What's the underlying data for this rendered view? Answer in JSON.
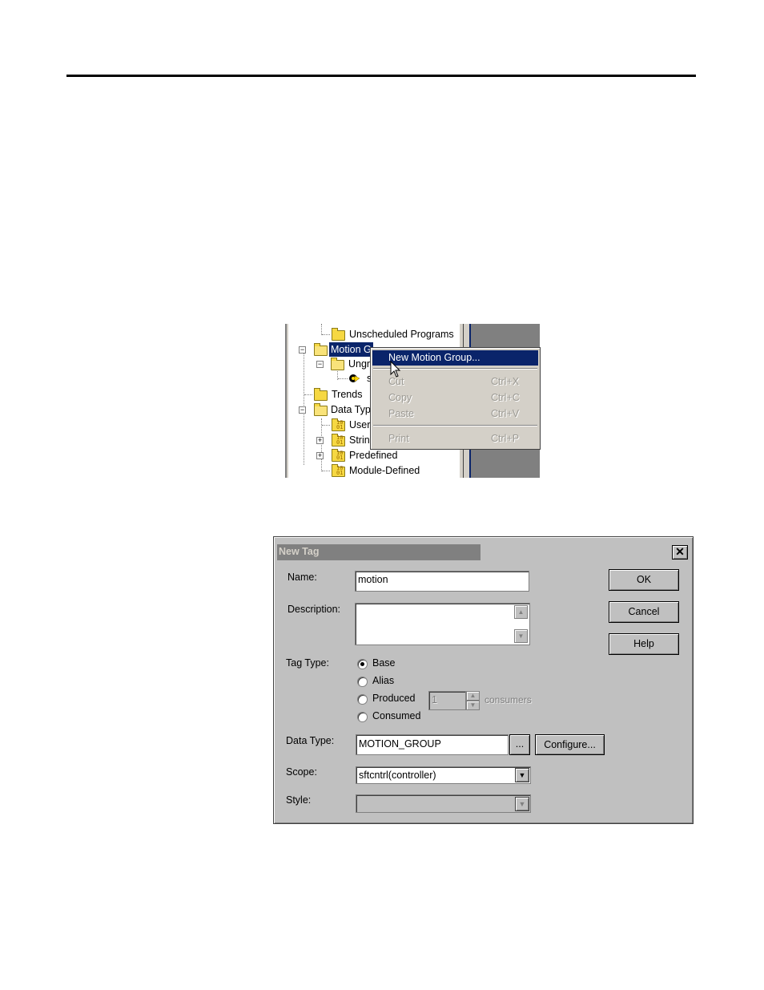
{
  "tree": {
    "items": [
      {
        "label": "Unscheduled Programs"
      },
      {
        "label": "Motion G"
      },
      {
        "label": "Ungr"
      },
      {
        "label": "s"
      },
      {
        "label": "Trends"
      },
      {
        "label": "Data Typ"
      },
      {
        "label": "User"
      },
      {
        "label": "Strin"
      },
      {
        "label": "Predefined"
      },
      {
        "label": "Module-Defined"
      }
    ]
  },
  "context_menu": {
    "items": [
      {
        "label": "New Motion Group...",
        "shortcut": ""
      },
      {
        "label": "Cut",
        "shortcut": "Ctrl+X"
      },
      {
        "label": "Copy",
        "shortcut": "Ctrl+C"
      },
      {
        "label": "Paste",
        "shortcut": "Ctrl+V"
      },
      {
        "label": "Print",
        "shortcut": "Ctrl+P"
      }
    ]
  },
  "dialog": {
    "title": "New Tag",
    "close": "✕",
    "name_label": "Name:",
    "name_value": "motion",
    "description_label": "Description:",
    "description_value": "",
    "tag_type_label": "Tag Type:",
    "tag_type_options": [
      "Base",
      "Alias",
      "Produced",
      "Consumed"
    ],
    "tag_type_selected": "Base",
    "consumers_value": "1",
    "consumers_label": "consumers",
    "data_type_label": "Data Type:",
    "data_type_value": "MOTION_GROUP",
    "browse_label": "...",
    "configure_label": "Configure...",
    "scope_label": "Scope:",
    "scope_value": "sftcntrl(controller)",
    "style_label": "Style:",
    "style_value": "",
    "ok_label": "OK",
    "cancel_label": "Cancel",
    "help_label": "Help"
  }
}
